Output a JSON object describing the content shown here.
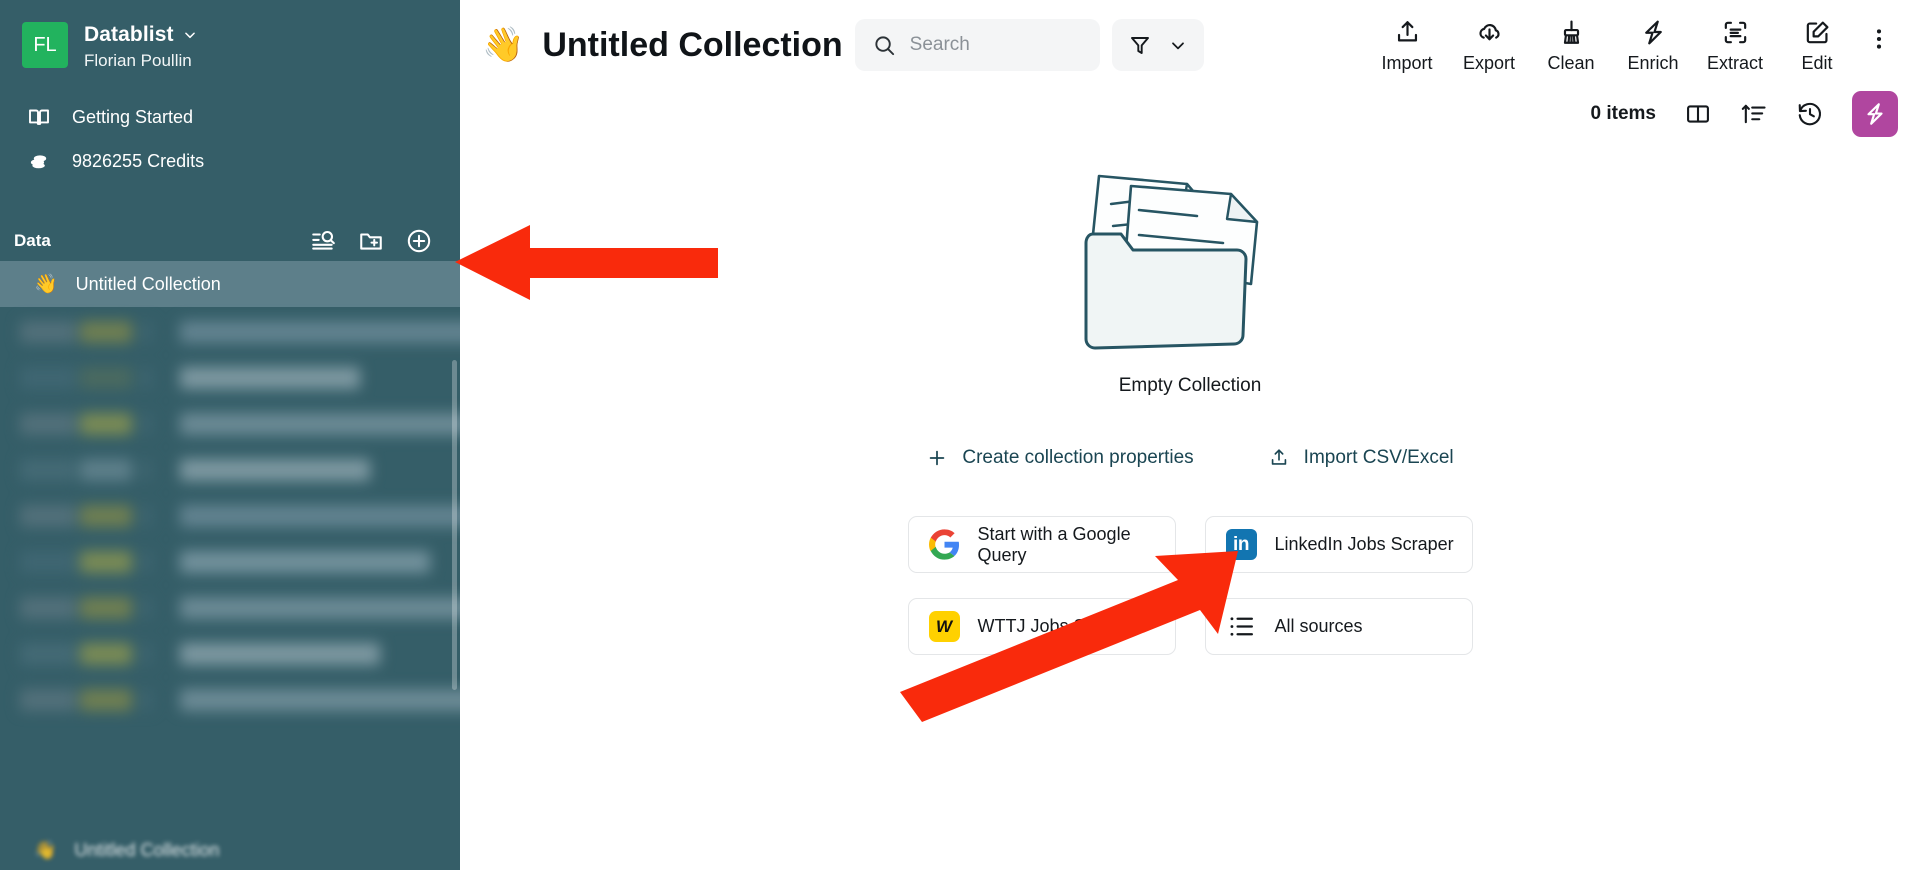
{
  "sidebar": {
    "avatar_initials": "FL",
    "org_name": "Datablist",
    "user_name": "Florian Poullin",
    "nav": [
      {
        "label": "Getting Started",
        "icon": "book-icon"
      },
      {
        "label": "9826255 Credits",
        "icon": "coins-icon"
      }
    ],
    "data_section": {
      "label": "Data",
      "actions": [
        {
          "name": "search-list-icon"
        },
        {
          "name": "new-folder-icon"
        },
        {
          "name": "add-collection-icon"
        }
      ]
    },
    "selected_collection": {
      "emoji": "👋",
      "label": "Untitled Collection"
    },
    "hidden_collection_label": "Untitled Collection",
    "colors": {
      "background": "#355e68",
      "selected_row": "#5d7f8a",
      "avatar": "#22b35e"
    }
  },
  "header": {
    "emoji": "👋",
    "title": "Untitled Collection",
    "search": {
      "placeholder": "Search",
      "value": ""
    },
    "filter": {
      "icon": "filter-icon",
      "chevron": "chevron-down-icon"
    },
    "tools": [
      {
        "label": "Import",
        "icon": "upload-icon"
      },
      {
        "label": "Export",
        "icon": "cloud-download-icon"
      },
      {
        "label": "Clean",
        "icon": "broom-icon"
      },
      {
        "label": "Enrich",
        "icon": "lightning-icon"
      },
      {
        "label": "Extract",
        "icon": "scan-text-icon"
      },
      {
        "label": "Edit",
        "icon": "pencil-square-icon"
      }
    ],
    "more_menu_icon": "kebab-menu-icon"
  },
  "subbar": {
    "items_count": "0 items",
    "icons": [
      {
        "name": "columns-icon"
      },
      {
        "name": "sort-icon"
      },
      {
        "name": "history-icon"
      }
    ],
    "flash_button": {
      "icon": "lightning-icon",
      "color": "#b0469f"
    }
  },
  "empty_state": {
    "illustration": "empty-folder-illustration",
    "title": "Empty Collection",
    "links": [
      {
        "label": "Create collection properties",
        "icon": "plus-icon"
      },
      {
        "label": "Import CSV/Excel",
        "icon": "upload-icon"
      }
    ],
    "cards": [
      {
        "label": "Start with a Google Query",
        "icon": "google-logo"
      },
      {
        "label": "LinkedIn Jobs Scraper",
        "icon": "linkedin-logo"
      },
      {
        "label": "WTTJ Jobs Scraper",
        "icon": "wttj-logo"
      },
      {
        "label": "All sources",
        "icon": "list-icon"
      }
    ],
    "link_color": "#1a4552"
  },
  "annotations": {
    "color": "#f92a0c",
    "arrows": [
      {
        "name": "arrow-to-add-collection",
        "direction": "left"
      },
      {
        "name": "arrow-to-import-csv",
        "direction": "up-right"
      }
    ]
  }
}
